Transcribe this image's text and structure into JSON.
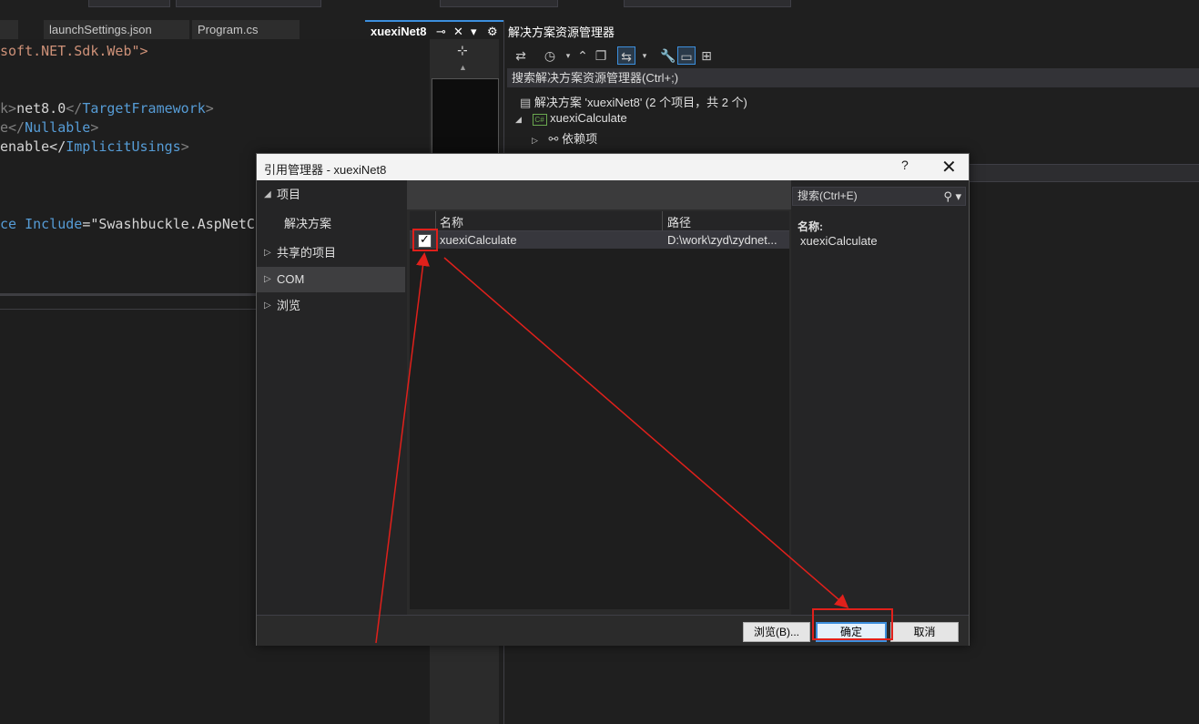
{
  "editor_tabs": [
    {
      "label": "launchSettings.json"
    },
    {
      "label": "Program.cs"
    },
    {
      "label": "xuexiNet8"
    }
  ],
  "editor_lines": {
    "l1": "soft.NET.Sdk.Web\">",
    "l2_a": "k>",
    "l2_b": "net8.0",
    "l2_c": "</",
    "l2_d": "TargetFramework",
    "l2_e": ">",
    "l3_a": "e</",
    "l3_b": "Nullable",
    "l3_c": ">",
    "l4_a": "enable</",
    "l4_b": "ImplicitUsings",
    "l4_c": ">",
    "l5_a": "ce ",
    "l5_b": "Include",
    "l5_c": "=\"Swashbuckle.AspNetCor"
  },
  "solution_explorer": {
    "title": "解决方案资源管理器",
    "search_placeholder": "搜索解决方案资源管理器(Ctrl+;)",
    "tree": {
      "solution": "解决方案 'xuexiNet8' (2 个项目，共 2 个)",
      "project": "xuexiCalculate",
      "dependencies": "依赖项"
    }
  },
  "dialog": {
    "title": "引用管理器 - xuexiNet8",
    "help": "?",
    "close": "✕",
    "nav": [
      {
        "label": "项目",
        "expanded": true
      },
      {
        "label": "解决方案",
        "child": true
      },
      {
        "label": "共享的项目"
      },
      {
        "label": "COM",
        "selected": true
      },
      {
        "label": "浏览"
      }
    ],
    "list": {
      "columns": [
        "名称",
        "路径"
      ],
      "rows": [
        {
          "name": "xuexiCalculate",
          "path": "D:\\work\\zyd\\zydnet...",
          "checked": true
        }
      ]
    },
    "search_placeholder": "搜索(Ctrl+E)",
    "details": {
      "name_label": "名称:",
      "name_value": "xuexiCalculate"
    },
    "buttons": {
      "browse": "浏览(B)...",
      "ok": "确定",
      "cancel": "取消"
    }
  },
  "colors": {
    "annotation": "#e0201b",
    "accent": "#3c8fdd"
  }
}
